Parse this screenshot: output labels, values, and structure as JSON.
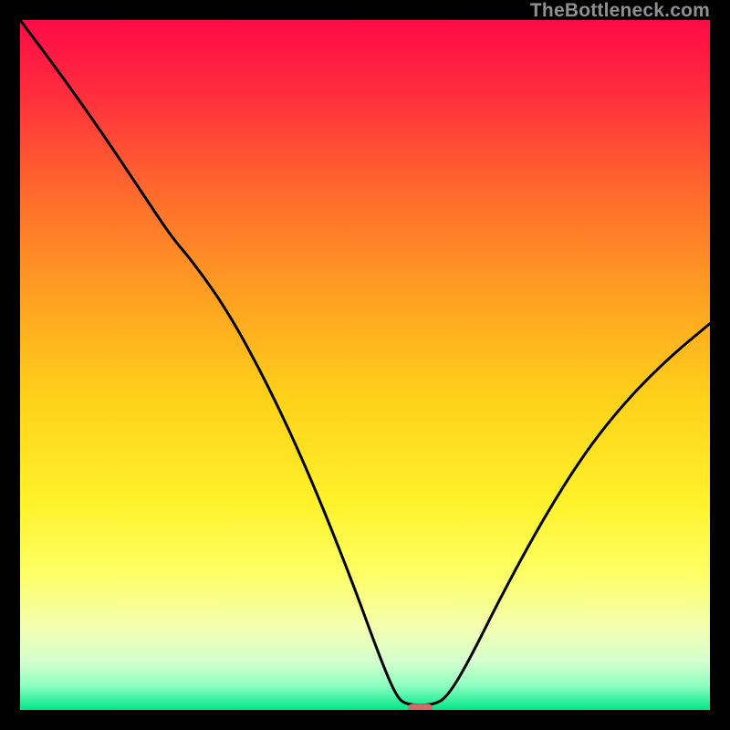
{
  "watermark": "TheBottleneck.com",
  "chart_data": {
    "type": "line",
    "title": "",
    "xlabel": "",
    "ylabel": "",
    "xlim": [
      0,
      100
    ],
    "ylim": [
      0,
      100
    ],
    "background": {
      "type": "vertical-gradient",
      "stops": [
        {
          "pos": 0.0,
          "color": "#ff0b47"
        },
        {
          "pos": 0.1,
          "color": "#ff2b3d"
        },
        {
          "pos": 0.25,
          "color": "#ff6a2c"
        },
        {
          "pos": 0.4,
          "color": "#ffa021"
        },
        {
          "pos": 0.55,
          "color": "#ffd21a"
        },
        {
          "pos": 0.7,
          "color": "#fff22a"
        },
        {
          "pos": 0.8,
          "color": "#fdff63"
        },
        {
          "pos": 0.88,
          "color": "#f3ffb0"
        },
        {
          "pos": 0.93,
          "color": "#d4ffcf"
        },
        {
          "pos": 0.965,
          "color": "#8dffc0"
        },
        {
          "pos": 1.0,
          "color": "#00e78a"
        }
      ]
    },
    "series": [
      {
        "name": "bottleneck-curve",
        "stroke": "#000000",
        "stroke_width": 3,
        "points": [
          {
            "x": 0.0,
            "y": 100.0
          },
          {
            "x": 6.0,
            "y": 92.0
          },
          {
            "x": 12.0,
            "y": 83.5
          },
          {
            "x": 18.0,
            "y": 74.5
          },
          {
            "x": 22.0,
            "y": 68.5
          },
          {
            "x": 25.0,
            "y": 65.0
          },
          {
            "x": 30.0,
            "y": 58.0
          },
          {
            "x": 36.0,
            "y": 47.0
          },
          {
            "x": 42.0,
            "y": 34.0
          },
          {
            "x": 48.0,
            "y": 19.0
          },
          {
            "x": 52.0,
            "y": 8.0
          },
          {
            "x": 54.5,
            "y": 2.0
          },
          {
            "x": 56.0,
            "y": 0.7
          },
          {
            "x": 60.0,
            "y": 0.7
          },
          {
            "x": 62.0,
            "y": 2.0
          },
          {
            "x": 65.0,
            "y": 7.0
          },
          {
            "x": 70.0,
            "y": 17.0
          },
          {
            "x": 76.0,
            "y": 28.0
          },
          {
            "x": 82.0,
            "y": 37.5
          },
          {
            "x": 88.0,
            "y": 45.0
          },
          {
            "x": 94.0,
            "y": 51.0
          },
          {
            "x": 100.0,
            "y": 56.0
          }
        ]
      }
    ],
    "marker": {
      "name": "optimal-point",
      "shape": "rounded-rect",
      "cx": 58.0,
      "cy": 0.0,
      "width": 3.6,
      "height": 1.8,
      "fill": "#d46a6a"
    }
  }
}
